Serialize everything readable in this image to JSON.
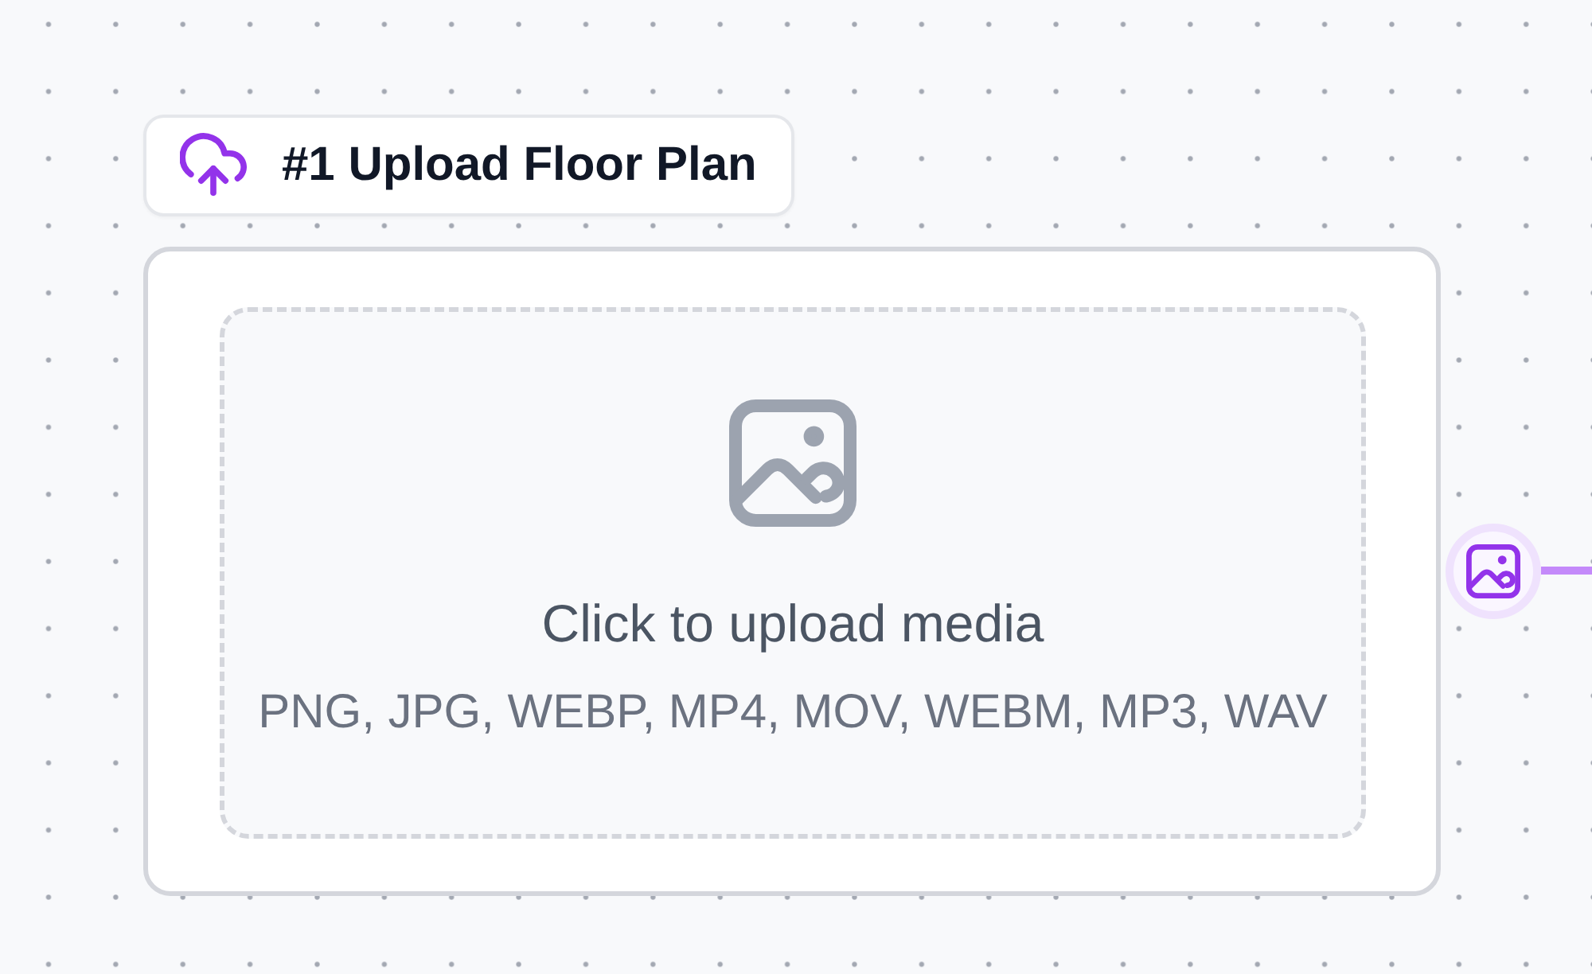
{
  "node": {
    "title": "#1 Upload Floor Plan",
    "dropzone": {
      "prompt": "Click to upload media",
      "formats": "PNG, JPG, WEBP, MP4, MOV, WEBM, MP3, WAV"
    },
    "output_port": {
      "connected": true
    }
  }
}
